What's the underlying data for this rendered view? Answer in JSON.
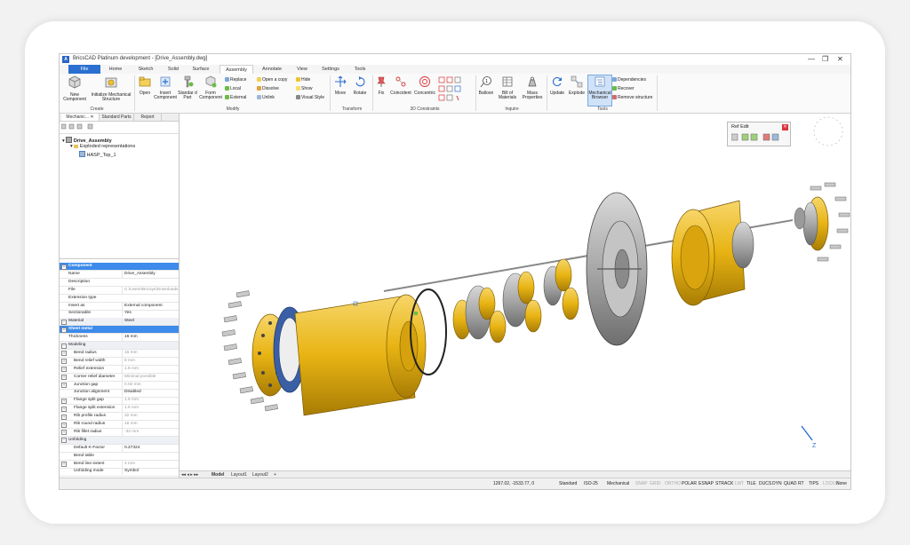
{
  "window": {
    "title": "BricsCAD Platinum development - [Drive_Assembly.dwg]",
    "logo": "A",
    "controls": [
      "—",
      "❐",
      "✕"
    ]
  },
  "tabs": [
    "File",
    "Home",
    "Sketch",
    "Solid",
    "Surface",
    "Assembly",
    "Annotate",
    "View",
    "Settings",
    "Tools"
  ],
  "active_tab": "Assembly",
  "ribbon": {
    "create": {
      "new_component": [
        "New",
        "Component"
      ],
      "initialize": [
        "Initialize Mechanical",
        "Structure"
      ],
      "label": "Create"
    },
    "modify": {
      "open": "Open",
      "insert_component": [
        "Insert",
        "Component"
      ],
      "standard_part": [
        "Standar d",
        "Part"
      ],
      "form_component": [
        "Form",
        "Component"
      ],
      "replace": "Replace",
      "local": "Local",
      "external": "External",
      "open_copy": "Open a copy",
      "dissolve": "Dissolve",
      "unlink": "Unlink",
      "hide": "Hide",
      "show": "Show",
      "visual_style": "Visual Style",
      "label": "Modify"
    },
    "transform": {
      "move": "Move",
      "rotate": "Rotate",
      "label": "Transform"
    },
    "constraints": {
      "fix": "Fix",
      "coincident": "Coincident",
      "concentric": "Concentric",
      "label": "3D Constraints"
    },
    "inquire": {
      "balloon": "Balloon",
      "bill": [
        "Bill of",
        "Materials"
      ],
      "mass": [
        "Mass",
        "Properties"
      ],
      "label": "Inquire"
    },
    "tools": {
      "update": "Update",
      "explode": "Explode",
      "mech_browser": [
        "Mechanical",
        "Browser"
      ],
      "dependencies": "Dependencies",
      "recover": "Recover",
      "remove_structure": "Remove structure",
      "label": "Tools"
    }
  },
  "panel": {
    "tabs": [
      "Mechanic...",
      "Standard Parts",
      "Report"
    ],
    "close": "✕",
    "tree": {
      "root": "Drive_Assembly",
      "exploded": "Exploded representations",
      "hasp": "HASP_Top_1"
    },
    "properties": [
      {
        "kind": "hdr",
        "key": "Component",
        "value": ""
      },
      {
        "kind": "row",
        "key": "Name",
        "value": "Drive_Assembly"
      },
      {
        "kind": "row",
        "key": "Description",
        "value": ""
      },
      {
        "kind": "row",
        "key": "File",
        "value": "C:\\Users\\Bricsys\\Downloads",
        "grey": true
      },
      {
        "kind": "row",
        "key": "Extension type",
        "value": ""
      },
      {
        "kind": "row",
        "key": "Insert as",
        "value": "External component"
      },
      {
        "kind": "row",
        "key": "Sectionable",
        "value": "Yes"
      },
      {
        "kind": "sec",
        "key": "Material",
        "value": "Steel"
      },
      {
        "kind": "hdr",
        "key": "Sheet metal",
        "value": ""
      },
      {
        "kind": "row",
        "key": "Thickness",
        "value": "16 mm"
      },
      {
        "kind": "sec",
        "key": "Modeling",
        "value": ""
      },
      {
        "kind": "sub",
        "key": "Bend radius",
        "value": "16 mm",
        "grey": true
      },
      {
        "kind": "sub",
        "key": "Bend relief width",
        "value": "8 mm",
        "grey": true
      },
      {
        "kind": "sub",
        "key": "Relief extension",
        "value": "1.6 mm",
        "grey": true
      },
      {
        "kind": "sub",
        "key": "Corner relief diameter",
        "value": "Minimal possible",
        "grey": true
      },
      {
        "kind": "sub",
        "key": "Junction gap",
        "value": "0.02 mm",
        "grey": true
      },
      {
        "kind": "row2",
        "key": "Junction alignment",
        "value": "Disabled"
      },
      {
        "kind": "sub",
        "key": "Flange split gap",
        "value": "1.6 mm",
        "grey": true
      },
      {
        "kind": "sub",
        "key": "Flange split extension",
        "value": "1.6 mm",
        "grey": true
      },
      {
        "kind": "sub",
        "key": "Rib profile radius",
        "value": "32 mm",
        "grey": true
      },
      {
        "kind": "sub",
        "key": "Rib round radius",
        "value": "16 mm",
        "grey": true
      },
      {
        "kind": "sub",
        "key": "Rib fillet radius",
        "value": "-32 mm",
        "grey": true
      },
      {
        "kind": "sec",
        "key": "Unfolding",
        "value": ""
      },
      {
        "kind": "row2",
        "key": "Default K-Factor",
        "value": "0.27324"
      },
      {
        "kind": "row2",
        "key": "Bend table",
        "value": ""
      },
      {
        "kind": "sub",
        "key": "Bend line extent",
        "value": "4 mm",
        "grey": true
      },
      {
        "kind": "row2",
        "key": "Unfolding mode",
        "value": "Symbol"
      }
    ]
  },
  "viewport": {
    "ref_edit_title": "Ref Edit",
    "ref_edit_close": "✕",
    "axis_label": "Z"
  },
  "layout_tabs": [
    "Model",
    "Layout1",
    "Layout2"
  ],
  "layout_add": "+",
  "status": {
    "coords": "1267.02, -1533.77, 0",
    "items_on": [
      "Standard",
      "ISO-25",
      "Mechanical"
    ],
    "toggles": [
      {
        "label": "SNAP",
        "on": false
      },
      {
        "label": "GRID",
        "on": false
      },
      {
        "label": "ORTHO",
        "on": false
      },
      {
        "label": "POLAR",
        "on": true
      },
      {
        "label": "ESNAP",
        "on": true
      },
      {
        "label": "STRACK",
        "on": true
      },
      {
        "label": "LWT",
        "on": false
      },
      {
        "label": "TILE",
        "on": true
      },
      {
        "label": "DUCS",
        "on": true
      },
      {
        "label": "DYN",
        "on": true
      },
      {
        "label": "QUAD",
        "on": true
      },
      {
        "label": "RT",
        "on": true
      },
      {
        "label": "TIPS",
        "on": true
      },
      {
        "label": "LOCKUI",
        "on": false
      }
    ],
    "none": "None"
  },
  "colors": {
    "accent": "#2b6fd0",
    "gold": "#e8b413",
    "steel": "#9a9a9a",
    "header": "#3d8bea"
  }
}
